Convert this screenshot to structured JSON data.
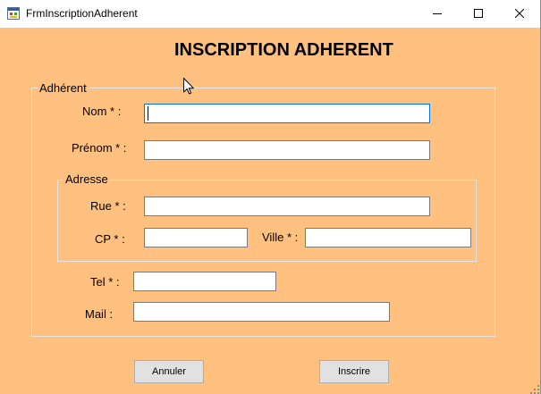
{
  "window": {
    "title": "FrmInscriptionAdherent",
    "app_icon": "winforms-app-icon",
    "controls": {
      "minimize": "minimize-icon",
      "maximize": "maximize-icon",
      "close": "close-icon"
    }
  },
  "theme": {
    "form_background": "#FFC080",
    "focus_border": "#0078D7"
  },
  "form": {
    "heading": "INSCRIPTION ADHERENT",
    "adherent": {
      "legend": "Adhérent",
      "nom": {
        "label": "Nom * :",
        "value": "",
        "focused": true
      },
      "prenom": {
        "label": "Prénom * :",
        "value": ""
      },
      "adresse": {
        "legend": "Adresse",
        "rue": {
          "label": "Rue * :",
          "value": ""
        },
        "cp": {
          "label": "CP * :",
          "value": ""
        },
        "ville": {
          "label": "Ville * :",
          "value": ""
        }
      },
      "tel": {
        "label": "Tel * :",
        "value": ""
      },
      "mail": {
        "label": "Mail :",
        "value": ""
      }
    },
    "buttons": {
      "cancel": "Annuler",
      "submit": "Inscrire"
    }
  },
  "cursor_icon": "mouse-pointer-icon",
  "resize_grip_icon": "resize-grip-icon"
}
